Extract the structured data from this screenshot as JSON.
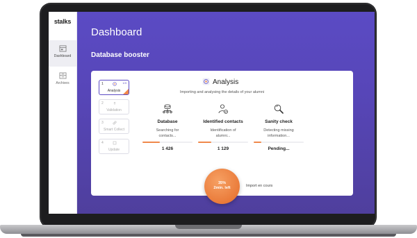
{
  "app": {
    "logo": "stalks"
  },
  "sidebar": {
    "items": [
      {
        "label": "Dashboard",
        "icon": "dashboard-icon",
        "active": true
      },
      {
        "label": "Archives",
        "icon": "archives-icon",
        "active": false
      }
    ]
  },
  "header": {
    "title": "Dashboard",
    "section": "Database booster"
  },
  "steps": [
    {
      "number": "1",
      "label": "Analysis",
      "count": "1/3",
      "active": true
    },
    {
      "number": "2",
      "label": "Validation",
      "active": false
    },
    {
      "number": "3",
      "label": "Smart Collect",
      "active": false
    },
    {
      "number": "4",
      "label": "Update",
      "active": false
    }
  ],
  "analysis": {
    "title": "Analysis",
    "subtitle": "Importing and analysing the details of your alumni",
    "metrics": [
      {
        "title": "Database",
        "desc_line1": "Searching for",
        "desc_line2": "contacts...",
        "value": "1 426",
        "progress": 0.35
      },
      {
        "title": "Identified contacts",
        "desc_line1": "Identification of",
        "desc_line2": "alumni...",
        "value": "1 129",
        "progress": 0.27
      },
      {
        "title": "Sanity check",
        "desc_line1": "Detecting missing",
        "desc_line2": "information...",
        "value": "Pending...",
        "progress": 0.15
      }
    ]
  },
  "progress": {
    "percent": "35%",
    "time_left": "2min. left",
    "status": "Import en cours",
    "value": 0.35
  },
  "colors": {
    "accent": "#5b4bc4",
    "orange": "#f0884a",
    "background_top": "#5b4bc4",
    "background_bottom": "#4f3f9d"
  }
}
